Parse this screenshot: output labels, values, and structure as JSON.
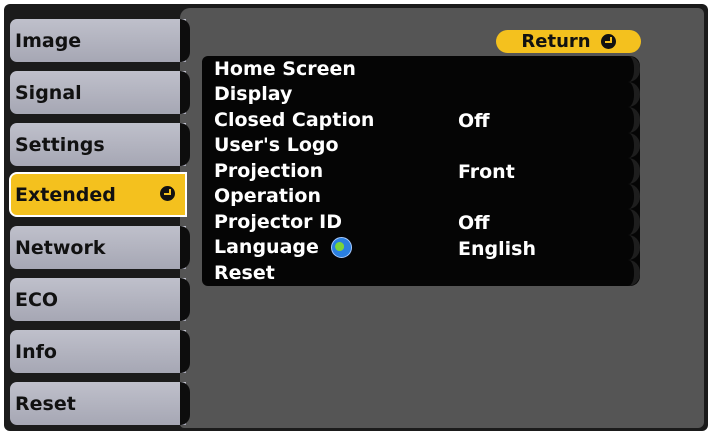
{
  "sidebar": {
    "tabs": [
      {
        "label": "Image",
        "selected": false
      },
      {
        "label": "Signal",
        "selected": false
      },
      {
        "label": "Settings",
        "selected": false
      },
      {
        "label": "Extended",
        "selected": true
      },
      {
        "label": "Network",
        "selected": false
      },
      {
        "label": "ECO",
        "selected": false
      },
      {
        "label": "Info",
        "selected": false
      },
      {
        "label": "Reset",
        "selected": false
      }
    ]
  },
  "main": {
    "return_label": "Return",
    "items": [
      {
        "label": "Home Screen",
        "value": ""
      },
      {
        "label": "Display",
        "value": ""
      },
      {
        "label": "Closed Caption",
        "value": "Off"
      },
      {
        "label": "User's Logo",
        "value": ""
      },
      {
        "label": "Projection",
        "value": "Front"
      },
      {
        "label": "Operation",
        "value": ""
      },
      {
        "label": "Projector ID",
        "value": "Off"
      },
      {
        "label": "Language",
        "value": "English",
        "icon": "globe-icon"
      },
      {
        "label": "Reset",
        "value": ""
      }
    ]
  },
  "colors": {
    "accent": "#f4c11e",
    "tab": "#b3b4c0",
    "panel": "#555555",
    "menu_bg": "#050505"
  }
}
